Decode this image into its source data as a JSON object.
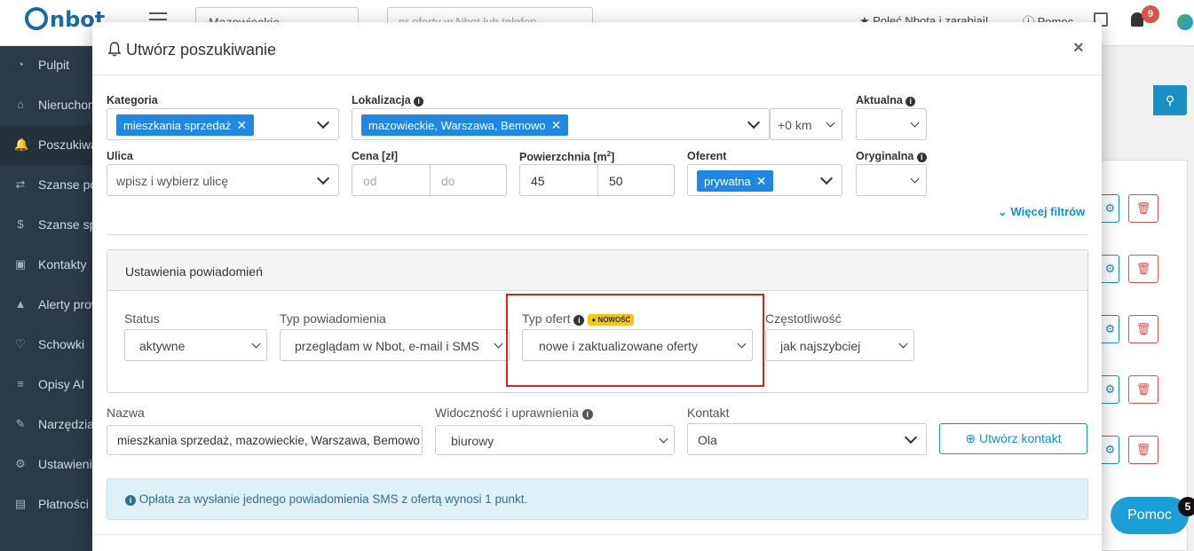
{
  "app": {
    "logo": "nbot",
    "region_select": "Mazowieckie",
    "search_placeholder": "nr oferty w Nbot lub telefon",
    "referral": "★ Poleć Nbota i zarabiaj!",
    "help": "Pomoc",
    "notifications_count": "9"
  },
  "sidebar": {
    "items": [
      {
        "label": "Pulpit",
        "icon": "◔"
      },
      {
        "label": "Nieruchomości",
        "icon": "⌂"
      },
      {
        "label": "Poszukiwania",
        "icon": "🔔"
      },
      {
        "label": "Szanse pozyskania",
        "icon": "⇄"
      },
      {
        "label": "Szanse sprzedaży",
        "icon": "$"
      },
      {
        "label": "Kontakty",
        "icon": "▣"
      },
      {
        "label": "Alerty prowizyjne",
        "icon": "▲"
      },
      {
        "label": "Schowki",
        "icon": "♡"
      },
      {
        "label": "Opisy AI",
        "icon": "≡"
      },
      {
        "label": "Narzędzia",
        "icon": "✎"
      },
      {
        "label": "Ustawienia",
        "icon": "⚙"
      },
      {
        "label": "Płatności",
        "icon": "▤"
      }
    ]
  },
  "modal": {
    "title": "Utwórz poszukiwanie",
    "close": "×",
    "filters": {
      "category": {
        "label": "Kategoria",
        "tag": "mieszkania sprzedaż"
      },
      "location": {
        "label": "Lokalizacja",
        "tag": "mazowieckie, Warszawa, Bemowo",
        "radius": "+0 km"
      },
      "current": {
        "label": "Aktualna"
      },
      "street": {
        "label": "Ulica",
        "placeholder": "wpisz i wybierz ulicę"
      },
      "price": {
        "label": "Cena [zł]",
        "from_placeholder": "od",
        "to_placeholder": "do"
      },
      "area": {
        "label": "Powierzchnia [m",
        "label_sup": "2",
        "label_end": "]",
        "from": "45",
        "to": "50"
      },
      "offerer": {
        "label": "Oferent",
        "tag": "prywatna"
      },
      "original": {
        "label": "Oryginalna"
      },
      "more": "⌄ Więcej filtrów"
    },
    "notifications": {
      "heading": "Ustawienia powiadomień",
      "status": {
        "label": "Status",
        "value": "aktywne"
      },
      "type": {
        "label": "Typ powiadomienia",
        "value": "przeglądam w Nbot, e-mail i SMS"
      },
      "offer_type": {
        "label": "Typ ofert",
        "badge": "NOWOŚĆ",
        "value": "nowe i zaktualizowane oferty"
      },
      "frequency": {
        "label": "Częstotliwość",
        "value": "jak najszybciej"
      }
    },
    "name": {
      "label": "Nazwa",
      "value": "mieszkania sprzedaż, mazowieckie, Warszawa, Bemowo"
    },
    "visibility": {
      "label": "Widoczność i uprawnienia",
      "value": "biurowy"
    },
    "contact": {
      "label": "Kontakt",
      "value": "Ola",
      "create_button": "Utwórz kontakt"
    },
    "sms_note": "Opłata za wysłanie jednego powiadomienia SMS z ofertą wynosi 1 punkt."
  },
  "help_widget": {
    "label": "Pomoc",
    "count": "5"
  },
  "colors": {
    "accent": "#1a8fc4",
    "tag": "#1e88e5",
    "highlight": "#e02020",
    "sidebar": "#2b3a46"
  }
}
